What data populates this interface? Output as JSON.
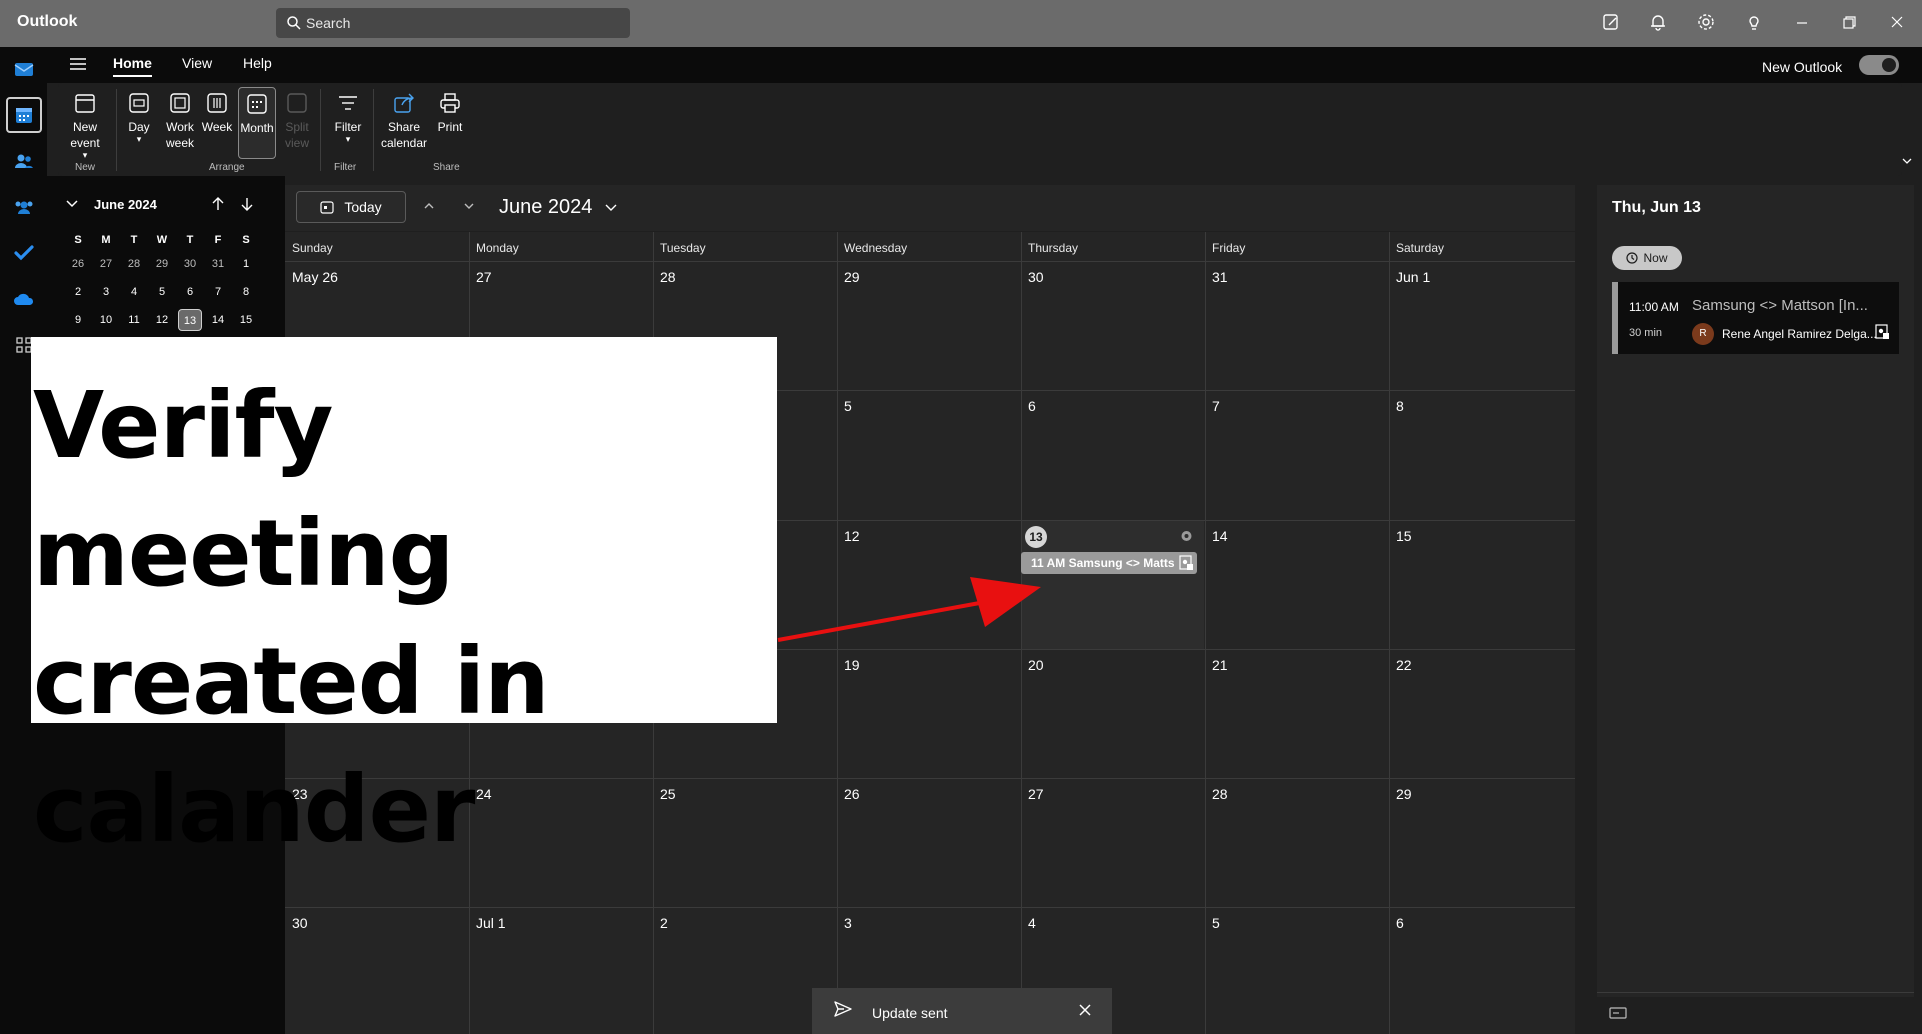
{
  "app": {
    "title": "Outlook"
  },
  "search": {
    "placeholder": "Search"
  },
  "ribbon": {
    "tabs": [
      "Home",
      "View",
      "Help"
    ],
    "new_outlook_label": "New Outlook",
    "buttons": {
      "new_event": "New event",
      "day": "Day",
      "work_week": "Work week",
      "week": "Week",
      "month": "Month",
      "split_view": "Split view",
      "filter": "Filter",
      "share_calendar": "Share calendar",
      "print": "Print"
    },
    "groups": {
      "new": "New",
      "arrange": "Arrange",
      "filter": "Filter",
      "share": "Share"
    }
  },
  "mini_calendar": {
    "title": "June 2024",
    "weekday_headers": [
      "S",
      "M",
      "T",
      "W",
      "T",
      "F",
      "S"
    ],
    "rows": [
      [
        "26",
        "27",
        "28",
        "29",
        "30",
        "31",
        "1"
      ],
      [
        "2",
        "3",
        "4",
        "5",
        "6",
        "7",
        "8"
      ],
      [
        "9",
        "10",
        "11",
        "12",
        "13",
        "14",
        "15"
      ]
    ],
    "today": "13"
  },
  "calendar": {
    "today_label": "Today",
    "month_title": "June 2024",
    "weekdays": [
      "Sunday",
      "Monday",
      "Tuesday",
      "Wednesday",
      "Thursday",
      "Friday",
      "Saturday"
    ],
    "weeks": [
      [
        "May 26",
        "27",
        "28",
        "29",
        "30",
        "31",
        "Jun 1"
      ],
      [
        "",
        "",
        "",
        "5",
        "6",
        "7",
        "8"
      ],
      [
        "",
        "",
        "",
        "12",
        "13",
        "14",
        "15"
      ],
      [
        "",
        "",
        "",
        "19",
        "20",
        "21",
        "22"
      ],
      [
        "23",
        "24",
        "25",
        "26",
        "27",
        "28",
        "29"
      ],
      [
        "30",
        "Jul 1",
        "2",
        "3",
        "4",
        "5",
        "6"
      ]
    ],
    "event_chip": "11 AM Samsung <> Matts"
  },
  "agenda": {
    "date": "Thu, Jun 13",
    "now_label": "Now",
    "event": {
      "time": "11:00 AM",
      "duration": "30 min",
      "title": "Samsung <> Mattson [In...",
      "avatar_initial": "R",
      "organizer": "Rene Angel Ramirez Delga..."
    }
  },
  "toast": {
    "text": "Update sent"
  },
  "annotation": {
    "text": "Verify meeting created in calander"
  },
  "colors": {
    "arrow": "#e81010",
    "title_bar": "#6b6b6b",
    "event_chip": "#9a9a9a",
    "avatar": "#7b3a1c"
  }
}
